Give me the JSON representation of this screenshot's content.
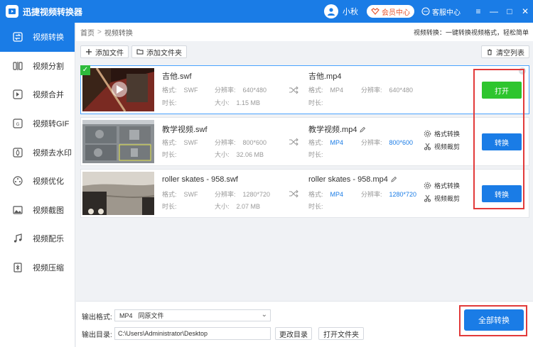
{
  "app": {
    "title": "迅捷视频转换器"
  },
  "header": {
    "username": "小秋",
    "vip_label": "会员中心",
    "support_label": "客服中心"
  },
  "window_controls": {
    "menu": "≡",
    "minimize": "—",
    "maximize": "□",
    "close": "✕"
  },
  "sidebar": {
    "items": [
      {
        "label": "视频转换",
        "icon": "convert-icon",
        "active": true
      },
      {
        "label": "视频分割",
        "icon": "split-icon"
      },
      {
        "label": "视频合并",
        "icon": "merge-icon"
      },
      {
        "label": "视频转GIF",
        "icon": "gif-icon"
      },
      {
        "label": "视频去水印",
        "icon": "watermark-icon"
      },
      {
        "label": "视频优化",
        "icon": "optimize-icon"
      },
      {
        "label": "视频截图",
        "icon": "screenshot-icon"
      },
      {
        "label": "视频配乐",
        "icon": "music-icon"
      },
      {
        "label": "视频压缩",
        "icon": "compress-icon"
      }
    ]
  },
  "breadcrumb": {
    "home": "首页",
    "sep": ">",
    "current": "视频转换"
  },
  "slogan": "视频转换：一键转换视频格式，轻松简单",
  "toolbar": {
    "add_file": "添加文件",
    "add_folder": "添加文件夹",
    "clear_list": "清空列表"
  },
  "labels": {
    "format": "格式:",
    "resolution": "分辨率:",
    "duration": "时长:",
    "size": "大小:"
  },
  "files": [
    {
      "src_name": "吉他.swf",
      "src_format": "SWF",
      "src_resolution": "640*480",
      "src_duration": "",
      "src_size": "1.15 MB",
      "dst_name": "吉他.mp4",
      "dst_format": "MP4",
      "dst_resolution": "640*480",
      "dst_duration": "",
      "action": "打开"
    },
    {
      "src_name": "教学视频.swf",
      "src_format": "SWF",
      "src_resolution": "800*600",
      "src_duration": "",
      "src_size": "32.06 MB",
      "dst_name": "教学视频.mp4",
      "dst_format": "MP4",
      "dst_resolution": "800*600",
      "dst_duration": "",
      "format_convert": "格式转换",
      "video_cut": "视频裁剪",
      "action": "转换"
    },
    {
      "src_name": "roller skates - 958.swf",
      "src_format": "SWF",
      "src_resolution": "1280*720",
      "src_duration": "",
      "src_size": "2.07 MB",
      "dst_name": "roller skates - 958.mp4",
      "dst_format": "MP4",
      "dst_resolution": "1280*720",
      "dst_duration": "",
      "format_convert": "格式转换",
      "video_cut": "视频裁剪",
      "action": "转换"
    }
  ],
  "bottom": {
    "output_format_label": "输出格式:",
    "output_format": "MP4",
    "output_format_desc": "同原文件",
    "output_dir_label": "输出目录:",
    "output_dir": "C:\\Users\\Administrator\\Desktop",
    "change_dir": "更改目录",
    "open_folder": "打开文件夹",
    "convert_all": "全部转换"
  },
  "colors": {
    "accent": "#1a7ce6",
    "open_green": "#2ec52e",
    "highlight_red": "#e23a3a"
  }
}
